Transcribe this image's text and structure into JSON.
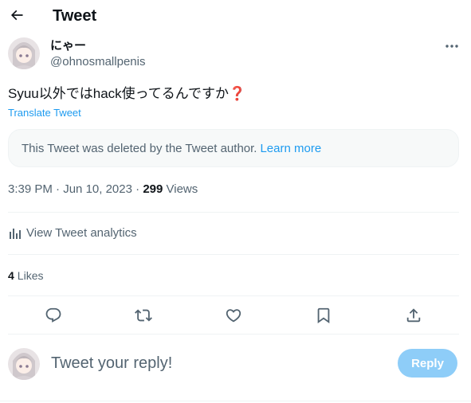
{
  "header": {
    "title": "Tweet",
    "back_icon": "arrow-left-icon"
  },
  "tweet": {
    "author": {
      "display_name": "にゃー",
      "handle": "@ohnosmallpenis"
    },
    "text": "Syuu以外ではhack使ってるんですか",
    "emoji": "❓",
    "translate_label": "Translate Tweet",
    "quoted_notice": {
      "text": "This Tweet was deleted by the Tweet author.",
      "link_label": "Learn more"
    },
    "time": "3:39 PM",
    "date": "Jun 10, 2023",
    "separator": "·",
    "views_count": "299",
    "views_label": "Views",
    "analytics_label": "View Tweet analytics",
    "likes_count": "4",
    "likes_label": "Likes"
  },
  "actions": [
    "reply-icon",
    "retweet-icon",
    "like-icon",
    "bookmark-icon",
    "share-icon"
  ],
  "reply_box": {
    "placeholder": "Tweet your reply!",
    "button_label": "Reply"
  },
  "colors": {
    "accent": "#1d9bf0",
    "muted": "#536471",
    "reply_button": "#8ecdf8"
  }
}
